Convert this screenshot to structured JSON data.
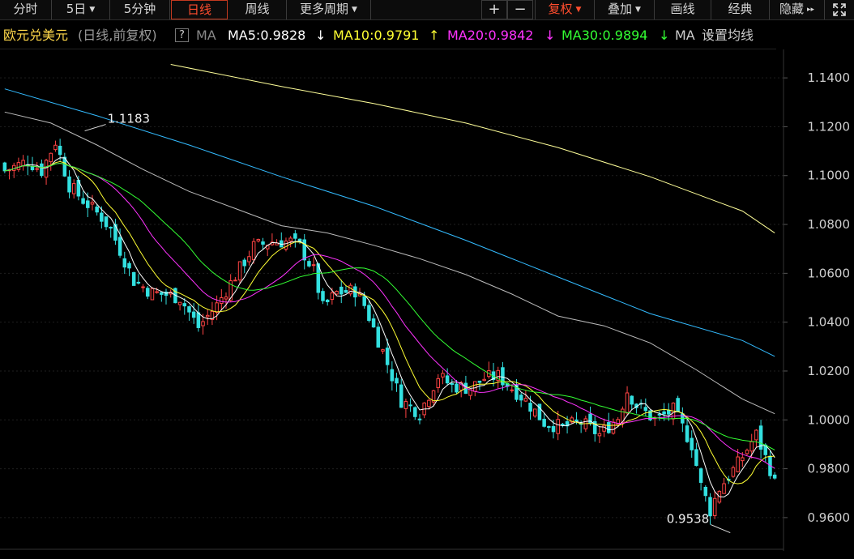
{
  "toolbar": {
    "items": [
      {
        "label": "分时",
        "caret": ""
      },
      {
        "label": "5日",
        "caret": "▼"
      },
      {
        "label": "5分钟",
        "caret": ""
      },
      {
        "label": "日线",
        "caret": ""
      },
      {
        "label": "周线",
        "caret": ""
      },
      {
        "label": "更多周期",
        "caret": "▼"
      }
    ],
    "zoom_in": "+",
    "zoom_out": "−",
    "right_items": [
      {
        "label": "复权",
        "caret": "▼"
      },
      {
        "label": "叠加",
        "caret": "▼"
      },
      {
        "label": "画线",
        "caret": ""
      },
      {
        "label": "经典",
        "caret": ""
      },
      {
        "label": "隐藏",
        "caret": "▸▸"
      }
    ],
    "expand_icon": "expand-icon"
  },
  "legend": {
    "symbol": "欧元兑美元",
    "mode": "(日线,前复权)",
    "help": "?",
    "ma_label": "MA",
    "ma5": {
      "text": "MA5:0.9828",
      "arrow": "↓",
      "color": "#ffffff"
    },
    "ma10": {
      "text": "MA10:0.9791",
      "arrow": "↑",
      "color": "#ffff33"
    },
    "ma20": {
      "text": "MA20:0.9842",
      "arrow": "↓",
      "color": "#ff33ff"
    },
    "ma30": {
      "text": "MA30:0.9894",
      "arrow": "↓",
      "color": "#33ff33"
    },
    "ma_more": "MA",
    "settings": "设置均线",
    "settings_caret": "▼"
  },
  "chart_data": {
    "type": "candlestick",
    "symbol": "欧元兑美元",
    "ylim": [
      0.953,
      1.148
    ],
    "y_ticks": [
      "1.1400",
      "1.1200",
      "1.1000",
      "1.0800",
      "1.0600",
      "1.0400",
      "1.0200",
      "1.0000",
      "0.9800",
      "0.9600"
    ],
    "up_color": "#ff4444",
    "down_color": "#33e0e0",
    "bars_shown": 168,
    "annotations": [
      {
        "label": "1.1183",
        "bar": 17,
        "price": 1.1183
      },
      {
        "label": "0.9538",
        "bar": 157,
        "price": 0.9538
      }
    ],
    "ma_series": [
      {
        "label": "MA5",
        "color": "#ffffff",
        "last": 0.9828
      },
      {
        "label": "MA10",
        "color": "#ffff33",
        "last": 0.9791
      },
      {
        "label": "MA20",
        "color": "#ff33ff",
        "last": 0.9842
      },
      {
        "label": "MA30",
        "color": "#33ff33",
        "last": 0.9894
      }
    ],
    "long_ma_lines": [
      {
        "color": "#bbbbbb",
        "points": [
          [
            0,
            1.126
          ],
          [
            10,
            1.1215
          ],
          [
            20,
            1.1125
          ],
          [
            30,
            1.1025
          ],
          [
            40,
            1.0935
          ],
          [
            50,
            1.0865
          ],
          [
            60,
            1.0795
          ],
          [
            70,
            1.0765
          ],
          [
            80,
            1.0715
          ],
          [
            90,
            1.066
          ],
          [
            100,
            1.0595
          ],
          [
            110,
            1.0515
          ],
          [
            120,
            1.0425
          ],
          [
            130,
            1.0385
          ],
          [
            140,
            1.0315
          ],
          [
            150,
            1.0205
          ],
          [
            160,
            1.0085
          ],
          [
            167,
            1.0025
          ]
        ]
      },
      {
        "color": "#33bbff",
        "points": [
          [
            0,
            1.1355
          ],
          [
            20,
            1.1245
          ],
          [
            40,
            1.1125
          ],
          [
            60,
            1.0995
          ],
          [
            80,
            1.0875
          ],
          [
            100,
            1.0735
          ],
          [
            120,
            1.0585
          ],
          [
            140,
            1.0435
          ],
          [
            160,
            1.0325
          ],
          [
            167,
            1.026
          ]
        ]
      },
      {
        "color": "#ffff99",
        "points": [
          [
            36,
            1.1455
          ],
          [
            60,
            1.1365
          ],
          [
            80,
            1.1295
          ],
          [
            100,
            1.1215
          ],
          [
            120,
            1.1115
          ],
          [
            140,
            1.0995
          ],
          [
            160,
            1.0855
          ],
          [
            167,
            1.0765
          ]
        ]
      }
    ]
  }
}
